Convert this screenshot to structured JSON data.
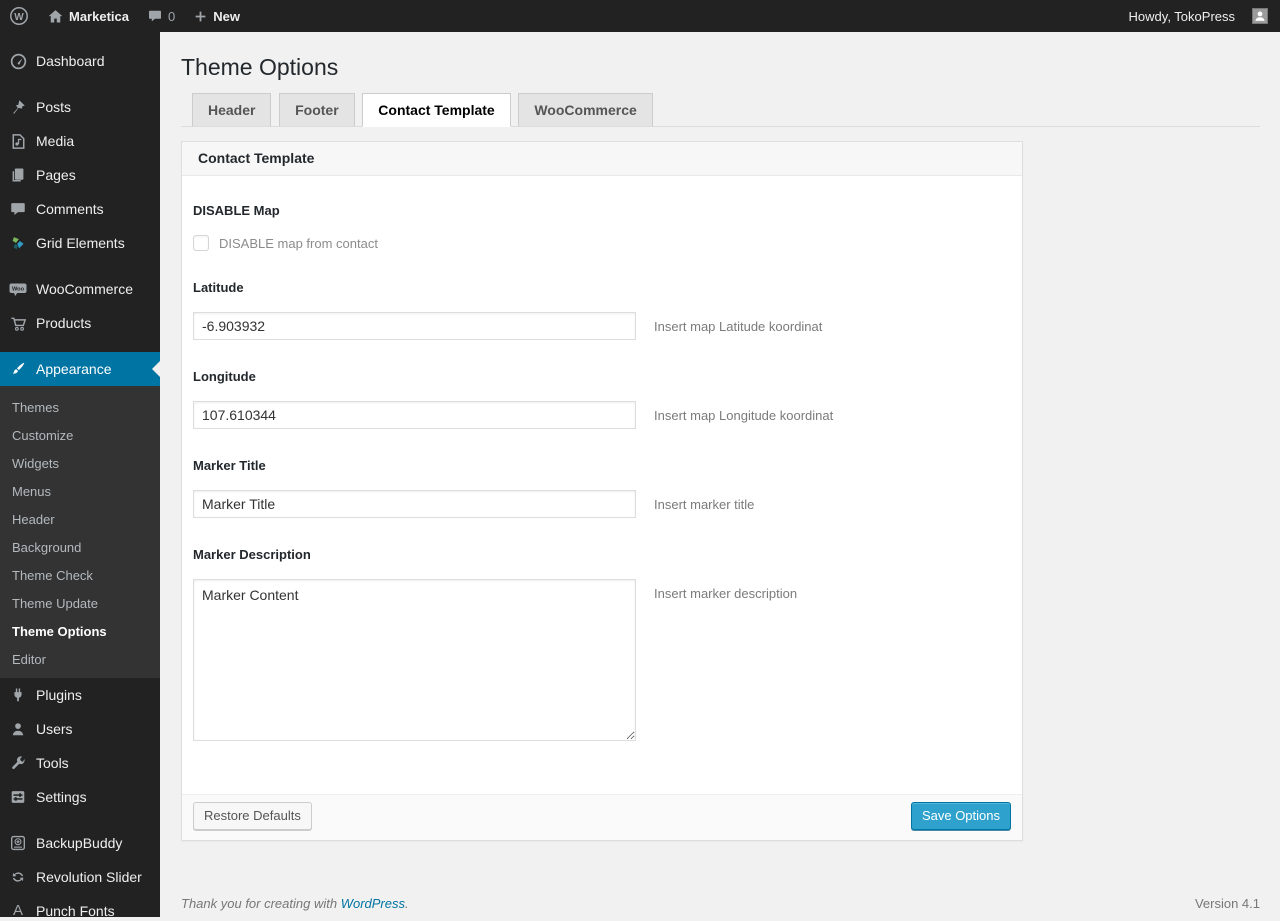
{
  "colors": {
    "accent": "#2ea2cc",
    "menu_highlight": "#0074a2",
    "link": "#0074a2",
    "adminbar_bg": "#222222",
    "content_bg": "#f1f1f1"
  },
  "icons": {
    "wp_logo_glyph": "W",
    "woo_badge": "Woo",
    "punch_fonts_glyph": "A"
  },
  "admin_bar": {
    "site_name": "Marketica",
    "comment_count": "0",
    "new_label": "New",
    "howdy": "Howdy, TokoPress"
  },
  "sidebar": {
    "items": [
      "Dashboard",
      "Posts",
      "Media",
      "Pages",
      "Comments",
      "Grid Elements",
      "WooCommerce",
      "Products",
      "Appearance",
      "Plugins",
      "Users",
      "Tools",
      "Settings",
      "BackupBuddy",
      "Revolution Slider",
      "Punch Fonts"
    ],
    "appearance_submenu": [
      "Themes",
      "Customize",
      "Widgets",
      "Menus",
      "Header",
      "Background",
      "Theme Check",
      "Theme Update",
      "Theme Options",
      "Editor"
    ]
  },
  "page": {
    "title": "Theme Options",
    "tabs": [
      {
        "label": "Header",
        "active": false
      },
      {
        "label": "Footer",
        "active": false
      },
      {
        "label": "Contact Template",
        "active": true
      },
      {
        "label": "WooCommerce",
        "active": false
      }
    ],
    "panel": {
      "title": "Contact Template",
      "fields": {
        "disable_map": {
          "label": "DISABLE Map",
          "checkbox_label": "DISABLE map from contact",
          "checked": false
        },
        "latitude": {
          "label": "Latitude",
          "value": "-6.903932",
          "hint": "Insert map Latitude koordinat"
        },
        "longitude": {
          "label": "Longitude",
          "value": "107.610344",
          "hint": "Insert map Longitude koordinat"
        },
        "marker_title": {
          "label": "Marker Title",
          "value": "Marker Title",
          "hint": "Insert marker title"
        },
        "marker_description": {
          "label": "Marker Description",
          "value": "Marker Content",
          "hint": "Insert marker description"
        }
      },
      "buttons": {
        "restore": "Restore Defaults",
        "save": "Save Options"
      }
    },
    "footer": {
      "thanks_prefix": "Thank you for creating with ",
      "wordpress_link": "WordPress",
      "thanks_suffix": ".",
      "version": "Version 4.1"
    }
  }
}
